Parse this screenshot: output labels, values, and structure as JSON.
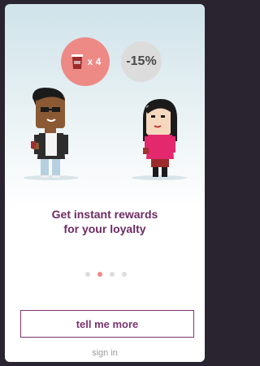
{
  "rewards": {
    "cup_multiplier": "x 4",
    "discount_label": "-15%"
  },
  "headline": {
    "line1": "Get instant rewards",
    "line2": "for your loyalty"
  },
  "carousel": {
    "page_count": 4,
    "active_index": 1
  },
  "actions": {
    "tell_me_more": "tell me more",
    "sign_in": "sign in"
  },
  "colors": {
    "accent": "#7b3570",
    "headline": "#6d2b63",
    "badge_red": "#ee8a86",
    "badge_grey": "#dcdcdc"
  }
}
